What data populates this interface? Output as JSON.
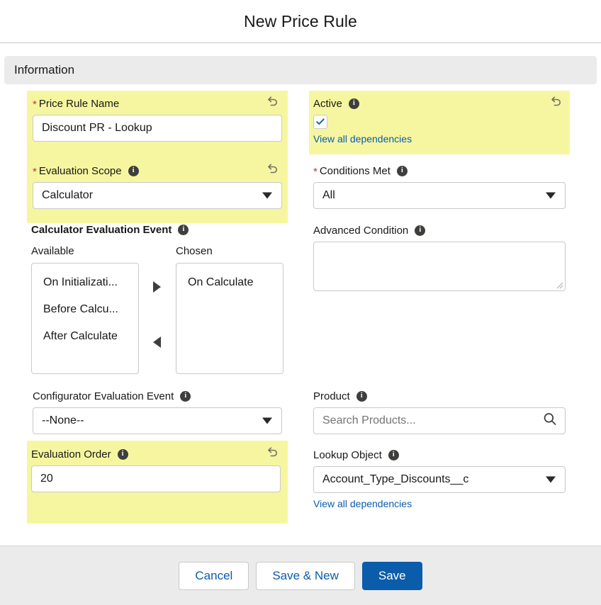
{
  "modal": {
    "title": "New Price Rule"
  },
  "section": {
    "title": "Information"
  },
  "icons": {
    "info": "i",
    "undo": "undo-icon",
    "search": "search-icon",
    "dropdown": "chevron-down-icon",
    "check": "check-icon",
    "move_right": "arrow-right-icon",
    "move_left": "arrow-left-icon"
  },
  "fields": {
    "price_rule_name": {
      "label": "Price Rule Name",
      "required": true,
      "value": "Discount PR - Lookup",
      "has_undo": true,
      "has_info": false
    },
    "evaluation_scope": {
      "label": "Evaluation Scope",
      "required": true,
      "value": "Calculator",
      "has_undo": true,
      "has_info": true
    },
    "calculator_evaluation_event": {
      "label": "Calculator Evaluation Event",
      "available_label": "Available",
      "chosen_label": "Chosen",
      "available": [
        "On Initializati...",
        "Before Calcu...",
        "After Calculate"
      ],
      "chosen": [
        "On Calculate"
      ],
      "has_info": true
    },
    "configurator_evaluation_event": {
      "label": "Configurator Evaluation Event",
      "value": "--None--",
      "has_info": true,
      "has_undo": false
    },
    "evaluation_order": {
      "label": "Evaluation Order",
      "value": "20",
      "has_info": true,
      "has_undo": true
    },
    "active": {
      "label": "Active",
      "checked": true,
      "dependencies_link": "View all dependencies",
      "has_info": true,
      "has_undo": true
    },
    "conditions_met": {
      "label": "Conditions Met",
      "required": true,
      "value": "All",
      "has_info": true,
      "has_undo": false
    },
    "advanced_condition": {
      "label": "Advanced Condition",
      "value": "",
      "has_info": true
    },
    "product": {
      "label": "Product",
      "value": "",
      "placeholder": "Search Products...",
      "has_info": true
    },
    "lookup_object": {
      "label": "Lookup Object",
      "value": "Account_Type_Discounts__c",
      "dependencies_link": "View all dependencies",
      "has_info": true
    }
  },
  "footer": {
    "cancel_label": "Cancel",
    "save_new_label": "Save & New",
    "save_label": "Save"
  },
  "colors": {
    "highlight_yellow": "#f6f6a0",
    "brand_blue": "#0b5cab",
    "link_blue": "#0b5cab",
    "required_red": "#c23934",
    "section_band": "#ebebeb"
  }
}
